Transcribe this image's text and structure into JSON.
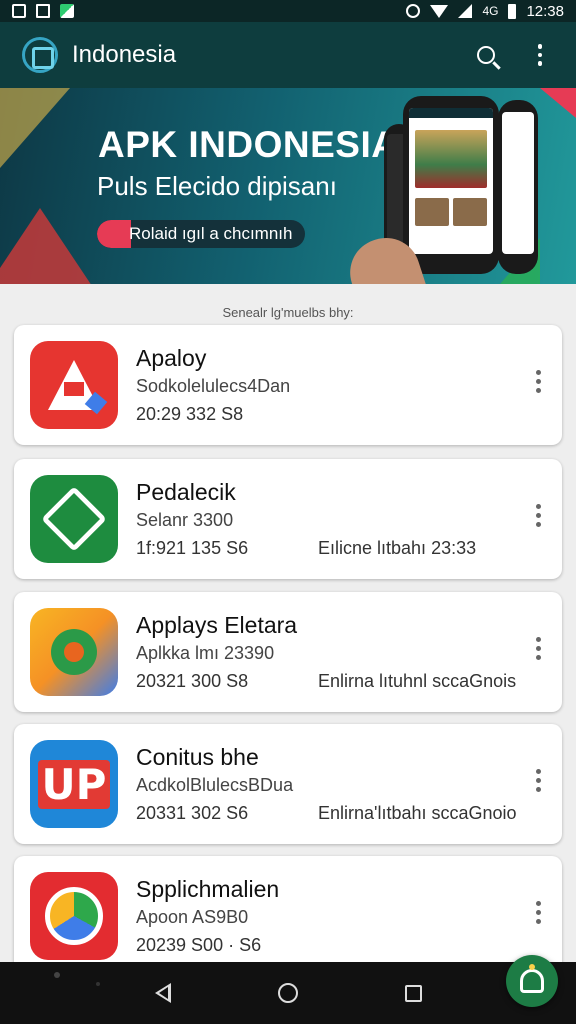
{
  "status_bar": {
    "time": "12:38",
    "signal_text": "4G",
    "icons": [
      "notification-icon",
      "image-icon",
      "download-icon",
      "alarm-icon",
      "wifi-icon",
      "signal-icon",
      "battery-icon"
    ]
  },
  "app_bar": {
    "title": "Indonesia",
    "icons": [
      "app-logo-icon",
      "search-icon",
      "more-vert-icon"
    ]
  },
  "banner": {
    "title": "APK INDONESIA",
    "subtitle": "Puls Elecido dipisanı",
    "cta_label": "Rolaid ıgıl a chcımnıh",
    "colors": {
      "accent": "#e63b55",
      "background": "#126170"
    }
  },
  "section_caption": "Senealr lg'muelbs bhy:",
  "apps": [
    {
      "name": "Apaloy",
      "subtitle": "Sodkolelulecs4Dan",
      "meta": "20:29  332   S8",
      "extra": "",
      "icon": "app-icon-a"
    },
    {
      "name": "Pedalecik",
      "subtitle": "Selanr 3300",
      "meta": "1f:921  135   S6",
      "extra": "Eılicne lıtbahı 23:33",
      "icon": "app-icon-b"
    },
    {
      "name": "Applays Eletara",
      "subtitle": "Aplkka lmı 23390",
      "meta": "20321  300   S8",
      "extra": "Enlirna lıtuhnl sccaGnois",
      "icon": "app-icon-c"
    },
    {
      "name": "Conitus bhe",
      "subtitle": "AcdkolBlulecsBDua",
      "meta": "20331  302   S6",
      "extra": "Enlirna'lıtbahı sccaGnoio",
      "icon": "app-icon-d",
      "icon_text": "UP"
    },
    {
      "name": "Spplichmalien",
      "subtitle": "Apoon AS9B0",
      "meta": "20239  S00 ·  S6",
      "extra": "",
      "icon": "app-icon-e"
    }
  ],
  "nav_bar": {
    "icons": [
      "back-icon",
      "home-icon",
      "recents-icon"
    ]
  },
  "fab": {
    "icon": "assistant-icon",
    "color": "#1d7c45"
  }
}
